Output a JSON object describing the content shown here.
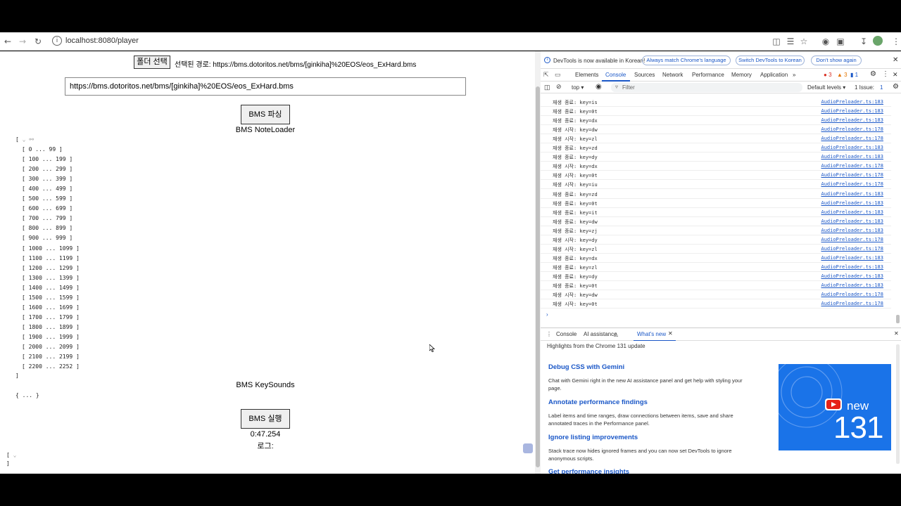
{
  "browser": {
    "url": "localhost:8080/player"
  },
  "page": {
    "folder_button": "폴더 선택",
    "selected_path": "선택된 경로: https://bms.dotoritos.net/bms/[ginkiha]%20EOS/eos_ExHard.bms",
    "url_input_value": "https://bms.dotoritos.net/bms/[ginkiha]%20EOS/eos_ExHard.bms",
    "parse_button": "BMS 파싱",
    "noteloader_title": "BMS NoteLoader",
    "array_open": "[",
    "array_close": "]",
    "ranges": [
      "[ 0 ... 99 ]",
      "[ 100 ... 199 ]",
      "[ 200 ... 299 ]",
      "[ 300 ... 399 ]",
      "[ 400 ... 499 ]",
      "[ 500 ... 599 ]",
      "[ 600 ... 699 ]",
      "[ 700 ... 799 ]",
      "[ 800 ... 899 ]",
      "[ 900 ... 999 ]",
      "[ 1000 ... 1099 ]",
      "[ 1100 ... 1199 ]",
      "[ 1200 ... 1299 ]",
      "[ 1300 ... 1399 ]",
      "[ 1400 ... 1499 ]",
      "[ 1500 ... 1599 ]",
      "[ 1600 ... 1699 ]",
      "[ 1700 ... 1799 ]",
      "[ 1800 ... 1899 ]",
      "[ 1900 ... 1999 ]",
      "[ 2000 ... 2099 ]",
      "[ 2100 ... 2199 ]",
      "[ 2200 ... 2252 ]"
    ],
    "keysounds_title": "BMS KeySounds",
    "keysounds_value": "{ ... }",
    "run_button": "BMS 실행",
    "time": "0:47.254",
    "log_label": "로그:",
    "log_open": "[",
    "log_close": "]"
  },
  "devtools": {
    "info_text": "DevTools is now available in Korean!",
    "info_btn1": "Always match Chrome's language",
    "info_btn2": "Switch DevTools to Korean",
    "info_btn3": "Don't show again",
    "tabs": [
      "Elements",
      "Console",
      "Sources",
      "Network",
      "Performance",
      "Memory",
      "Application"
    ],
    "errors": "3",
    "warnings": "3",
    "infos": "1",
    "context": "top",
    "filter_placeholder": "Filter",
    "levels": "Default levels",
    "issues": "1 Issue:",
    "issues_count": "1",
    "logs": [
      {
        "msg": "재생 종료: key=is",
        "src": "AudioPreloader.ts:183"
      },
      {
        "msg": "재생 종료: key=0t",
        "src": "AudioPreloader.ts:183"
      },
      {
        "msg": "재생 종료: key=dx",
        "src": "AudioPreloader.ts:183"
      },
      {
        "msg": "재생 시작: key=dw",
        "src": "AudioPreloader.ts:178"
      },
      {
        "msg": "재생 시작: key=zl",
        "src": "AudioPreloader.ts:178"
      },
      {
        "msg": "재생 종료: key=zd",
        "src": "AudioPreloader.ts:183"
      },
      {
        "msg": "재생 종료: key=dy",
        "src": "AudioPreloader.ts:183"
      },
      {
        "msg": "재생 시작: key=dx",
        "src": "AudioPreloader.ts:178"
      },
      {
        "msg": "재생 시작: key=0t",
        "src": "AudioPreloader.ts:178"
      },
      {
        "msg": "재생 시작: key=iu",
        "src": "AudioPreloader.ts:178"
      },
      {
        "msg": "재생 종료: key=zd",
        "src": "AudioPreloader.ts:183"
      },
      {
        "msg": "재생 종료: key=0t",
        "src": "AudioPreloader.ts:183"
      },
      {
        "msg": "재생 종료: key=it",
        "src": "AudioPreloader.ts:183"
      },
      {
        "msg": "재생 종료: key=dw",
        "src": "AudioPreloader.ts:183"
      },
      {
        "msg": "재생 종료: key=zj",
        "src": "AudioPreloader.ts:183"
      },
      {
        "msg": "재생 시작: key=dy",
        "src": "AudioPreloader.ts:178"
      },
      {
        "msg": "재생 시작: key=zl",
        "src": "AudioPreloader.ts:178"
      },
      {
        "msg": "재생 종료: key=dx",
        "src": "AudioPreloader.ts:183"
      },
      {
        "msg": "재생 종료: key=zl",
        "src": "AudioPreloader.ts:183"
      },
      {
        "msg": "재생 종료: key=dy",
        "src": "AudioPreloader.ts:183"
      },
      {
        "msg": "재생 종료: key=0t",
        "src": "AudioPreloader.ts:183"
      },
      {
        "msg": "재생 시작: key=dw",
        "src": "AudioPreloader.ts:178"
      },
      {
        "msg": "재생 시작: key=0t",
        "src": "AudioPreloader.ts:178"
      }
    ],
    "drawer_tabs": [
      "Console",
      "AI assistance",
      "What's new"
    ],
    "highlights": "Highlights from the Chrome 131 update",
    "whatsnew": [
      {
        "title": "Debug CSS with Gemini",
        "body": "Chat with Gemini right in the new AI assistance panel and get help with styling your page."
      },
      {
        "title": "Annotate performance findings",
        "body": "Label items and time ranges, draw connections between items, save and share annotated traces in the Performance panel."
      },
      {
        "title": "Ignore listing improvements",
        "body": "Stack trace now hides ignored frames and you can now set DevTools to ignore anonymous scripts."
      },
      {
        "title": "Get performance insights",
        "body": ""
      }
    ],
    "promo_new": "new",
    "promo_version": "131"
  }
}
